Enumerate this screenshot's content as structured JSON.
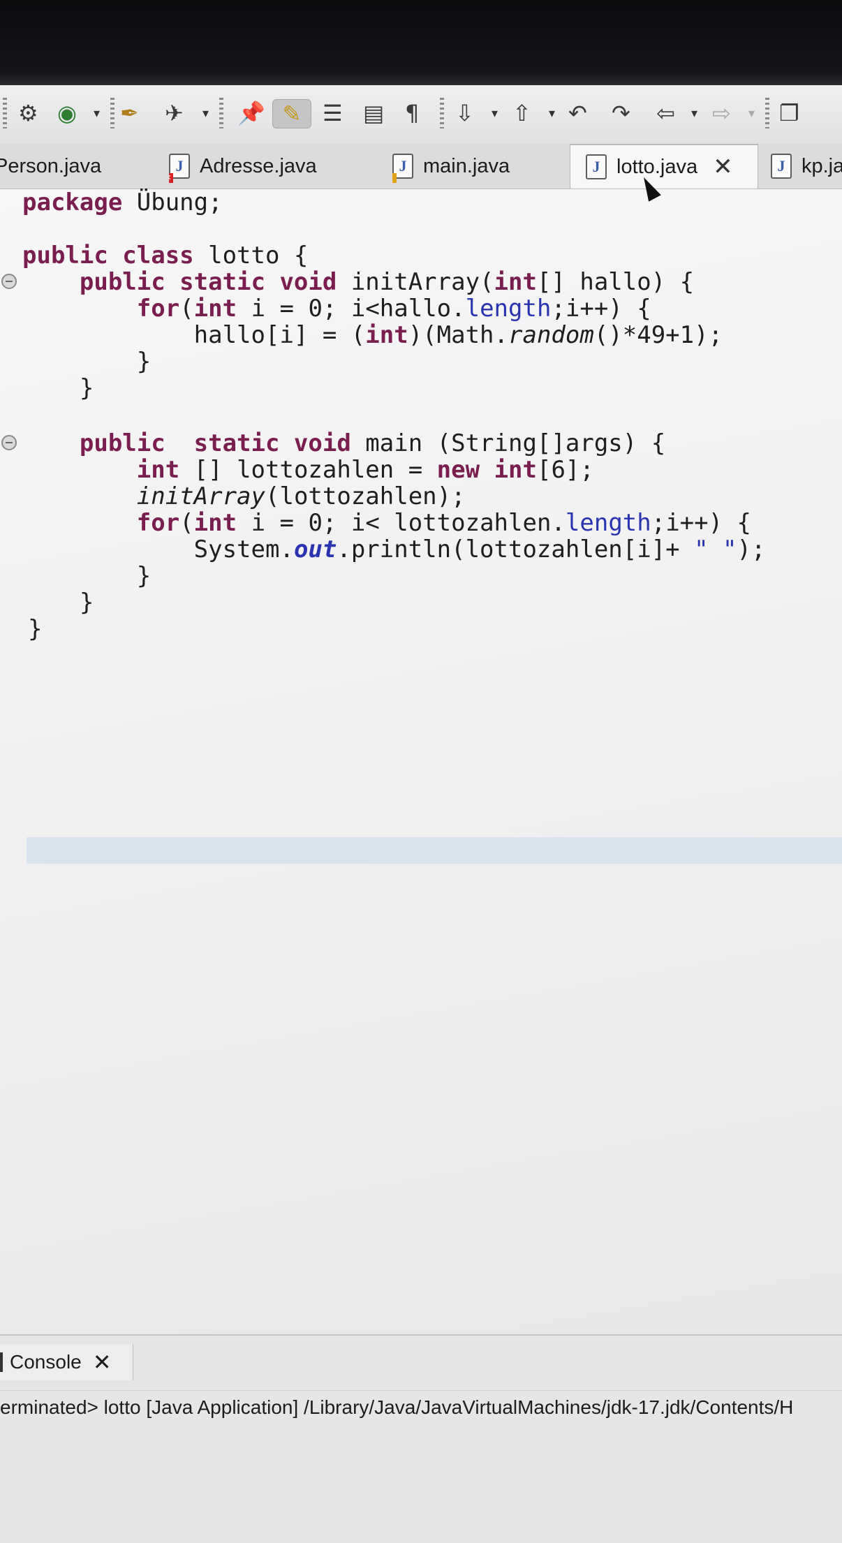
{
  "toolbar": {
    "icons": [
      "debug-icon",
      "run-icon",
      "open-type-icon",
      "launch-icon",
      "pin-icon",
      "highlight-icon",
      "toggle-breadcrumb-icon",
      "block-selection-icon",
      "show-whitespace-icon",
      "next-annotation-icon",
      "prev-annotation-icon",
      "last-edit-icon",
      "forward-edit-icon",
      "back-icon",
      "forward-icon",
      "maximize-icon"
    ]
  },
  "tabs": [
    {
      "label": "Person.java",
      "visible_label": "Person.java"
    },
    {
      "label": "Adresse.java"
    },
    {
      "label": "main.java"
    },
    {
      "label": "lotto.java",
      "active": true
    },
    {
      "label": "kp.ja"
    }
  ],
  "code": [
    {
      "kw": "package",
      "rest": " Übung;"
    },
    {
      "kw": "public class",
      "rest": " lotto {"
    },
    {
      "indent": "    ",
      "kw": "public static void",
      "rest": " initArray(",
      "kw2": "int",
      "rest2": "[] hallo) {"
    },
    {
      "indent": "        ",
      "kw": "for",
      "rest": "(",
      "kw2": "int",
      "rest2": " i = 0; i<hallo.",
      "fld": "length",
      "rest3": ";i++) {"
    },
    {
      "indent": "            ",
      "rest": "hallo[i] = (",
      "kw": "int",
      "rest2": ")(Math.",
      "it": "random",
      "rest3": "()*49+1);"
    },
    {
      "indent": "        ",
      "rest": "}"
    },
    {
      "indent": "    ",
      "rest": "}"
    },
    {
      "indent": "    ",
      "kw": "public  static void",
      "rest": " main (String[]args) {"
    },
    {
      "indent": "        ",
      "kw": "int",
      "rest": " [] lottozahlen = ",
      "kw2": "new",
      "rest2": " ",
      "kw3": "int",
      "rest3": "[6];"
    },
    {
      "indent": "        ",
      "it": "initArray",
      "rest": "(lottozahlen);"
    },
    {
      "indent": "        ",
      "kw": "for",
      "rest": "(",
      "kw2": "int",
      "rest2": " i = 0; i< lottozahlen.",
      "fld": "length",
      "rest3": ";i++) {"
    },
    {
      "indent": "            ",
      "rest": "System.",
      "sfld": "out",
      "rest2": ".println(lottozahlen[i]+ ",
      "str": "\" \"",
      "rest3": ");"
    },
    {
      "indent": "        ",
      "rest": "}"
    },
    {
      "indent": "    ",
      "rest": "}"
    },
    {
      "rest": "}"
    }
  ],
  "console": {
    "tab_label": "Console",
    "status": "erminated> lotto [Java Application] /Library/Java/JavaVirtualMachines/jdk-17.jdk/Contents/H"
  }
}
